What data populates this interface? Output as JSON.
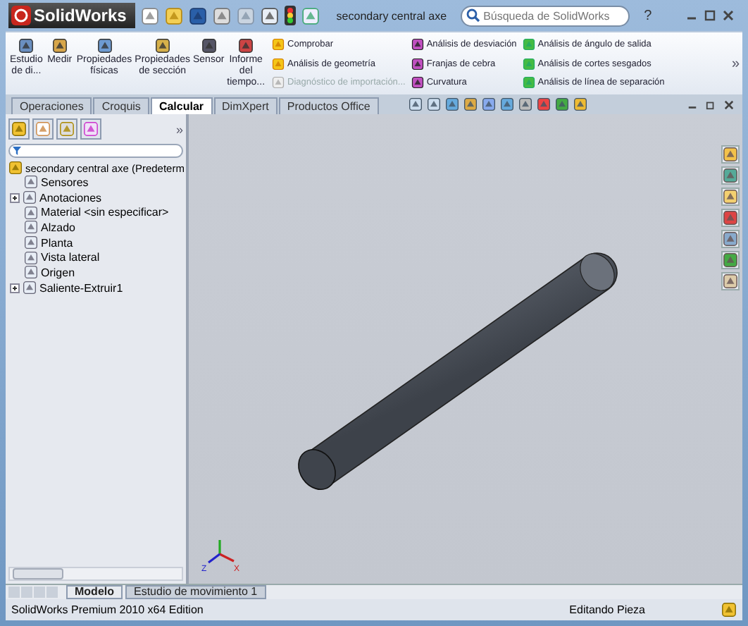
{
  "title_bar": {
    "logo": "SolidWorks",
    "document": "secondary central axe",
    "search": {
      "placeholder": "Búsqueda de SolidWorks"
    },
    "help": "?"
  },
  "ribbon": {
    "large_buttons": [
      {
        "label": "Estudio de di..."
      },
      {
        "label": "Medir"
      },
      {
        "label": "Propiedades físicas"
      },
      {
        "label": "Propiedades de sección"
      },
      {
        "label": "Sensor"
      },
      {
        "label": "Informe del tiempo..."
      }
    ],
    "small_columns": [
      [
        {
          "label": "Comprobar",
          "disabled": false
        },
        {
          "label": "Análisis de geometría",
          "disabled": false
        },
        {
          "label": "Diagnóstico de importación...",
          "disabled": true
        }
      ],
      [
        {
          "label": "Análisis de desviación",
          "disabled": false
        },
        {
          "label": "Franjas de cebra",
          "disabled": false
        },
        {
          "label": "Curvatura",
          "disabled": false
        }
      ],
      [
        {
          "label": "Análisis de ángulo de salida",
          "disabled": false
        },
        {
          "label": "Análisis de cortes sesgados",
          "disabled": false
        },
        {
          "label": "Análisis de línea de separación",
          "disabled": false
        }
      ]
    ],
    "more": "»"
  },
  "tabs": [
    {
      "label": "Operaciones",
      "selected": false
    },
    {
      "label": "Croquis",
      "selected": false
    },
    {
      "label": "Calcular",
      "selected": true
    },
    {
      "label": "DimXpert",
      "selected": false
    },
    {
      "label": "Productos Office",
      "selected": false
    }
  ],
  "feature_tree": {
    "more": "»",
    "root": "secondary central axe  (Predeterm",
    "items": [
      {
        "label": "Sensores",
        "expandable": false
      },
      {
        "label": "Anotaciones",
        "expandable": true
      },
      {
        "label": "Material <sin especificar>",
        "expandable": false
      },
      {
        "label": "Alzado",
        "expandable": false
      },
      {
        "label": "Planta",
        "expandable": false
      },
      {
        "label": "Vista lateral",
        "expandable": false
      },
      {
        "label": "Origen",
        "expandable": false
      },
      {
        "label": "Saliente-Extruir1",
        "expandable": true
      }
    ]
  },
  "triad": {
    "x": "X",
    "z": "Z"
  },
  "bottom_tabs": [
    {
      "label": "Modelo",
      "selected": true
    },
    {
      "label": "Estudio de movimiento 1",
      "selected": false
    }
  ],
  "status_bar": {
    "edition": "SolidWorks Premium 2010 x64 Edition",
    "mode": "Editando Pieza"
  }
}
